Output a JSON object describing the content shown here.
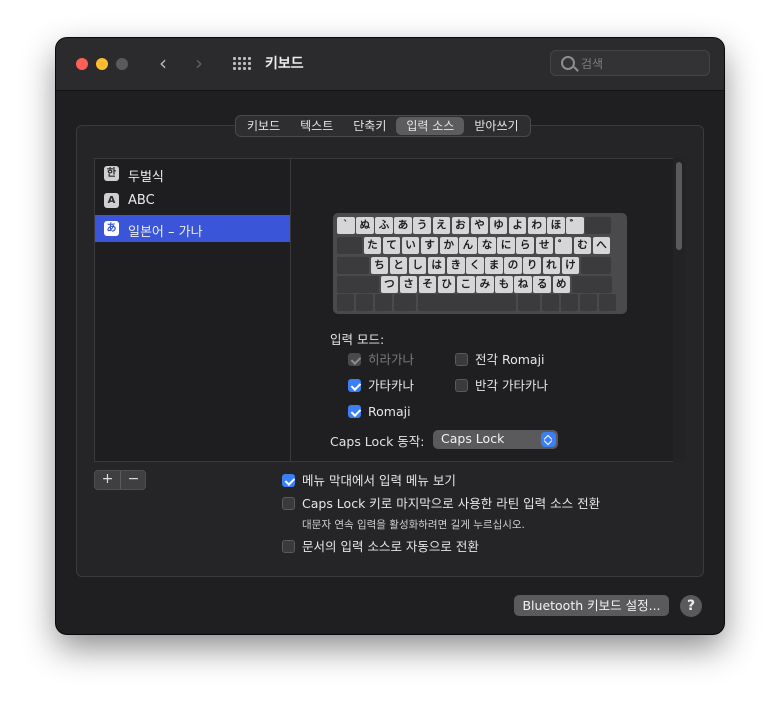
{
  "window": {
    "title": "키보드"
  },
  "toolbar": {
    "back_glyph": "‹",
    "forward_glyph": "›",
    "grid_icon": "grid-icon"
  },
  "search": {
    "placeholder": "검색",
    "value": ""
  },
  "tabs": [
    {
      "label": "키보드",
      "active": false
    },
    {
      "label": "텍스트",
      "active": false
    },
    {
      "label": "단축키",
      "active": false
    },
    {
      "label": "입력 소스",
      "active": true
    },
    {
      "label": "받아쓰기",
      "active": false
    }
  ],
  "input_sources": [
    {
      "icon": "한",
      "label": "두벌식",
      "selected": false
    },
    {
      "icon": "A",
      "label": "ABC",
      "selected": false
    },
    {
      "icon": "あ",
      "label": "일본어 – 가나",
      "selected": true
    }
  ],
  "keyboard": {
    "row1": [
      "`",
      "ぬ",
      "ふ",
      "あ",
      "う",
      "え",
      "お",
      "や",
      "ゆ",
      "よ",
      "わ",
      "ほ",
      "゛"
    ],
    "row2": [
      "た",
      "て",
      "い",
      "す",
      "か",
      "ん",
      "な",
      "に",
      "ら",
      "せ",
      "゜",
      "む",
      "へ"
    ],
    "row3": [
      "ち",
      "と",
      "し",
      "は",
      "き",
      "く",
      "ま",
      "の",
      "り",
      "れ",
      "け"
    ],
    "row4": [
      "つ",
      "さ",
      "そ",
      "ひ",
      "こ",
      "み",
      "も",
      "ね",
      "る",
      "め"
    ]
  },
  "input_mode": {
    "label": "입력 모드:",
    "options": [
      {
        "label": "히라가나",
        "checked": true,
        "disabled": true
      },
      {
        "label": "전각 Romaji",
        "checked": false,
        "disabled": false
      },
      {
        "label": "가타카나",
        "checked": true,
        "disabled": false
      },
      {
        "label": "반각 가타카나",
        "checked": false,
        "disabled": false
      },
      {
        "label": "Romaji",
        "checked": true,
        "disabled": false
      }
    ]
  },
  "caps_lock": {
    "label": "Caps Lock 동작:",
    "value": "Caps Lock"
  },
  "list_buttons": {
    "add": "+",
    "remove": "−"
  },
  "options": {
    "show_menu": {
      "label": "메뉴 막대에서 입력 메뉴 보기",
      "checked": true
    },
    "caps_switch": {
      "label": "Caps Lock 키로 마지막으로 사용한 라틴 입력 소스 전환",
      "checked": false
    },
    "caps_note": "대문자 연속 입력을 활성화하려면 길게 누르십시오.",
    "auto_switch": {
      "label": "문서의 입력 소스로 자동으로 전환",
      "checked": false
    }
  },
  "footer": {
    "bluetooth_button": "Bluetooth 키보드 설정...",
    "help": "?"
  },
  "colors": {
    "accent": "#3b7ff5",
    "selection": "#3a55d8",
    "close": "#ff5f57",
    "minimize": "#febc2e"
  }
}
